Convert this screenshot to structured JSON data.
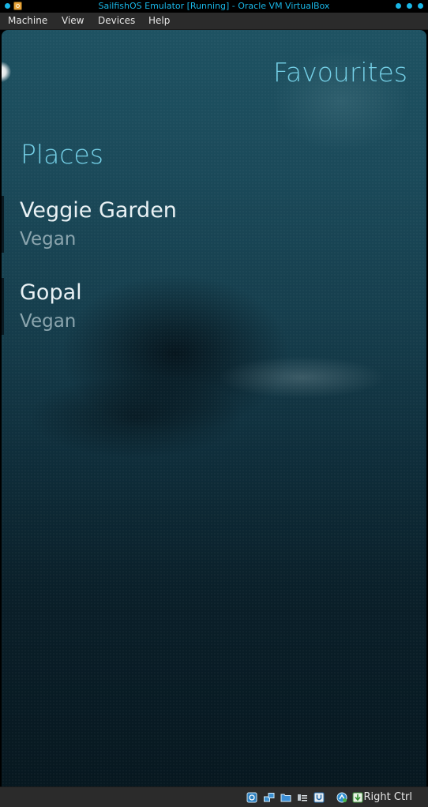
{
  "window": {
    "title": "SailfishOS Emulator [Running] - Oracle VM VirtualBox",
    "accent_color": "#19b6e6"
  },
  "menubar": {
    "items": [
      {
        "label": "Machine"
      },
      {
        "label": "View"
      },
      {
        "label": "Devices"
      },
      {
        "label": "Help"
      }
    ]
  },
  "page": {
    "title": "Favourites",
    "section_header": "Places",
    "highlight_color": "#74cfe6",
    "places": [
      {
        "name": "Veggie Garden",
        "category": "Vegan"
      },
      {
        "name": "Gopal",
        "category": "Vegan"
      }
    ]
  },
  "statusbar": {
    "icons": [
      "hard-disk-icon",
      "network-icon",
      "shared-folders-icon",
      "display-icon",
      "usb-icon",
      "mouse-integration-icon",
      "keyboard-capture-icon"
    ],
    "host_key": "Right Ctrl"
  }
}
